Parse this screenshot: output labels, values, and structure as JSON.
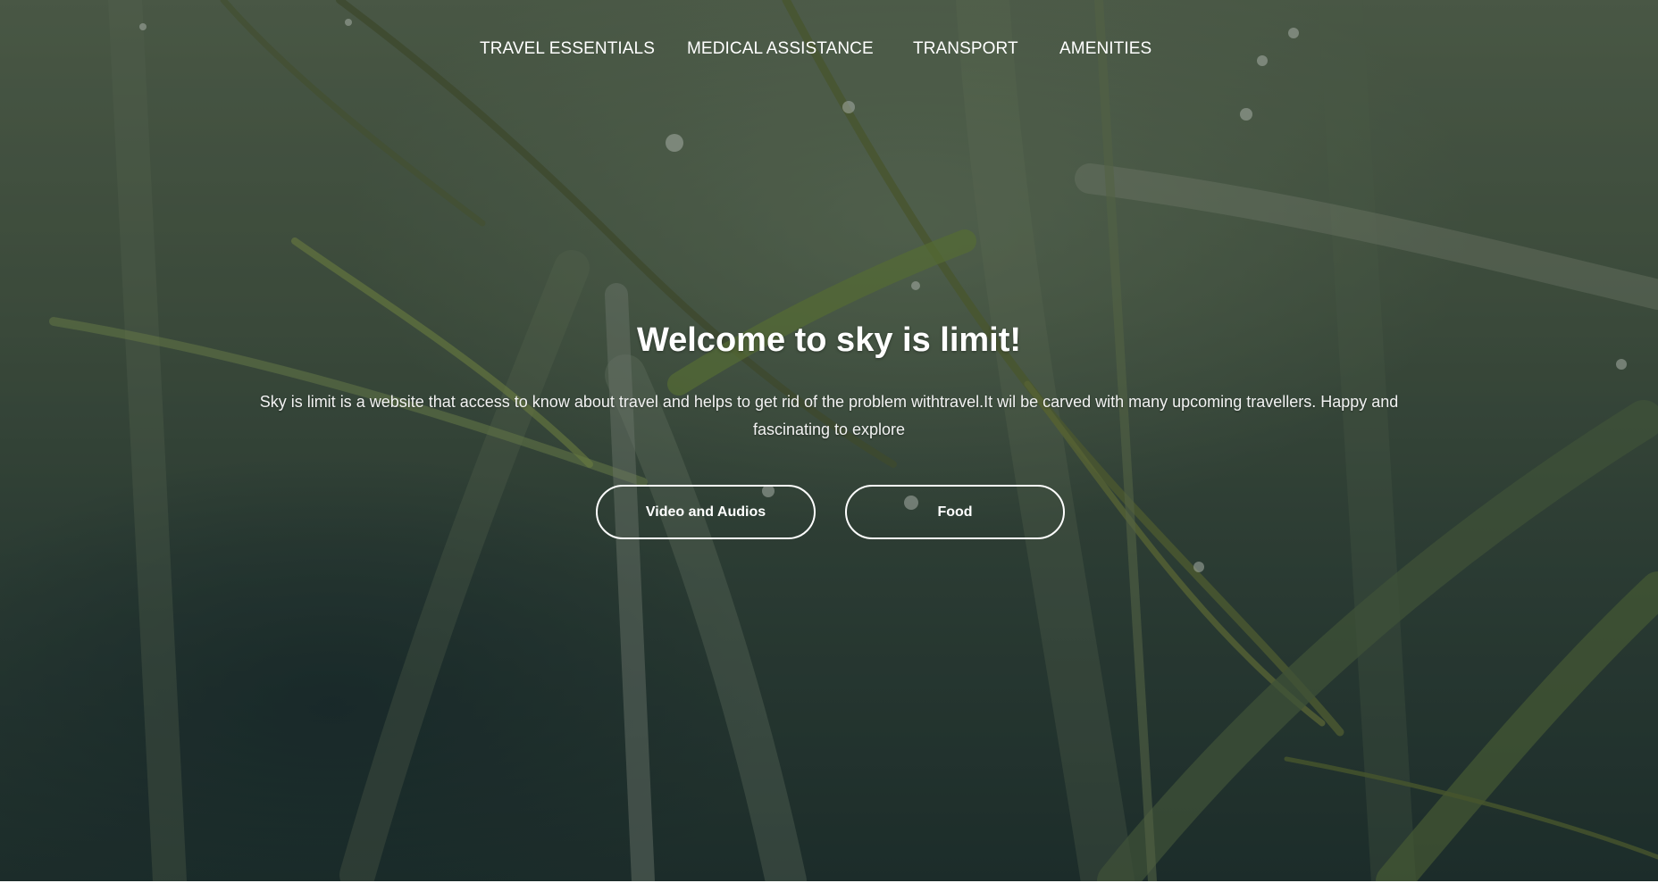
{
  "nav": {
    "items": [
      {
        "label": "TRAVEL ESSENTIALS"
      },
      {
        "label": "MEDICAL ASSISTANCE"
      },
      {
        "label": "TRANSPORT"
      },
      {
        "label": "AMENITIES"
      }
    ]
  },
  "hero": {
    "title": "Welcome to sky is limit!",
    "description": "Sky is limit is a website that access to know about travel and helps to get rid of the problem withtravel.It wil be carved with many upcoming travellers. Happy and fascinating to explore",
    "buttons": [
      {
        "label": "Video and Audios"
      },
      {
        "label": "Food"
      }
    ],
    "background_subject": "grass-blades-with-raindrops",
    "colors": {
      "text": "#ffffff",
      "background_dark": "#1f3331",
      "background_light": "#5d6e56"
    }
  }
}
